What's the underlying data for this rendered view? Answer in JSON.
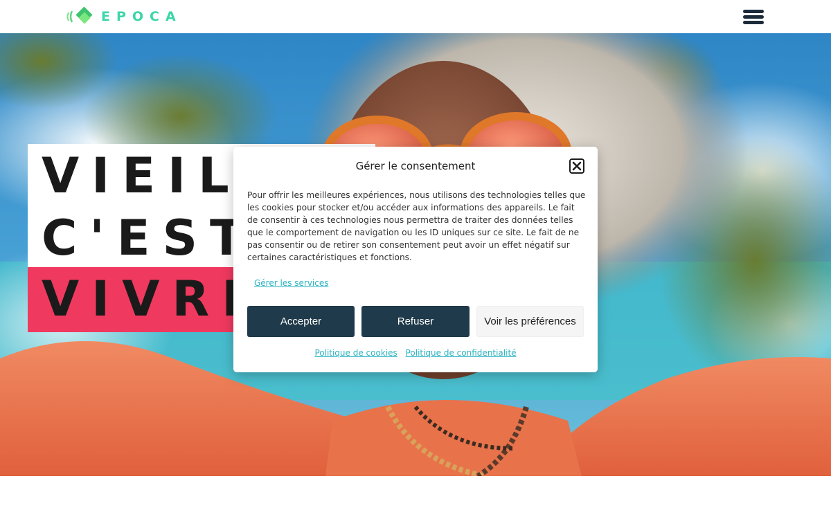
{
  "header": {
    "logo_text": "EPOCA",
    "logo_icon": "green-diamond-sound-icon",
    "menu_icon": "hamburger-menu-icon"
  },
  "hero": {
    "title_lines": [
      "VIEILLIR",
      "C'EST",
      "VIVRE"
    ],
    "image": "elderly woman with orange sunglasses dancing"
  },
  "consent": {
    "title": "Gérer le consentement",
    "body": "Pour offrir les meilleures expériences, nous utilisons des technologies telles que les cookies pour stocker et/ou accéder aux informations des appareils. Le fait de consentir à ces technologies nous permettra de traiter des données telles que le comportement de navigation ou les ID uniques sur ce site. Le fait de ne pas consentir ou de retirer son consentement peut avoir un effet négatif sur certaines caractéristiques et fonctions.",
    "manage_services": "Gérer les services",
    "accept": "Accepter",
    "refuse": "Refuser",
    "preferences": "Voir les préférences",
    "cookie_policy": "Politique de cookies",
    "privacy_policy": "Politique de confidentialité"
  },
  "colors": {
    "brand": "#3dd6a8",
    "accent_pink": "#f0395f",
    "button_dark": "#1f3a4a",
    "link": "#2bb3c0"
  }
}
